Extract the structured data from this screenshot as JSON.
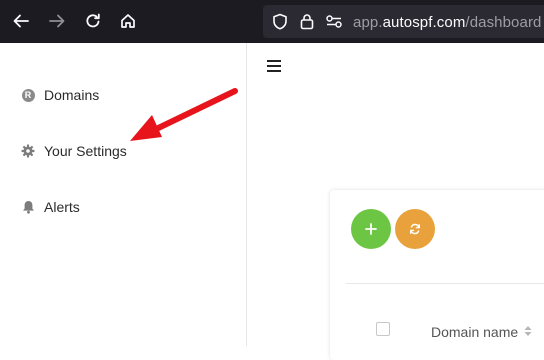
{
  "browser": {
    "url_prefix": "app.",
    "url_host": "autospf.com",
    "url_path": "/dashboard",
    "icons": [
      "back-icon",
      "forward-icon",
      "reload-icon",
      "home-icon",
      "shield-icon",
      "lock-icon",
      "permissions-icon"
    ]
  },
  "sidebar": {
    "items": [
      {
        "label": "Domains",
        "icon": "r-badge-icon",
        "badge": "R"
      },
      {
        "label": "Your Settings",
        "icon": "gear-icon"
      },
      {
        "label": "Alerts",
        "icon": "bell-icon"
      }
    ]
  },
  "main": {
    "add_label": "+",
    "table": {
      "columns": [
        "Domain name"
      ]
    }
  },
  "colors": {
    "toolbar_bg": "#1c1b22",
    "urlbar_bg": "#2b2a33",
    "add_button": "#6cc644",
    "sync_button": "#e9a23b",
    "annotation_arrow": "#e8141b"
  }
}
